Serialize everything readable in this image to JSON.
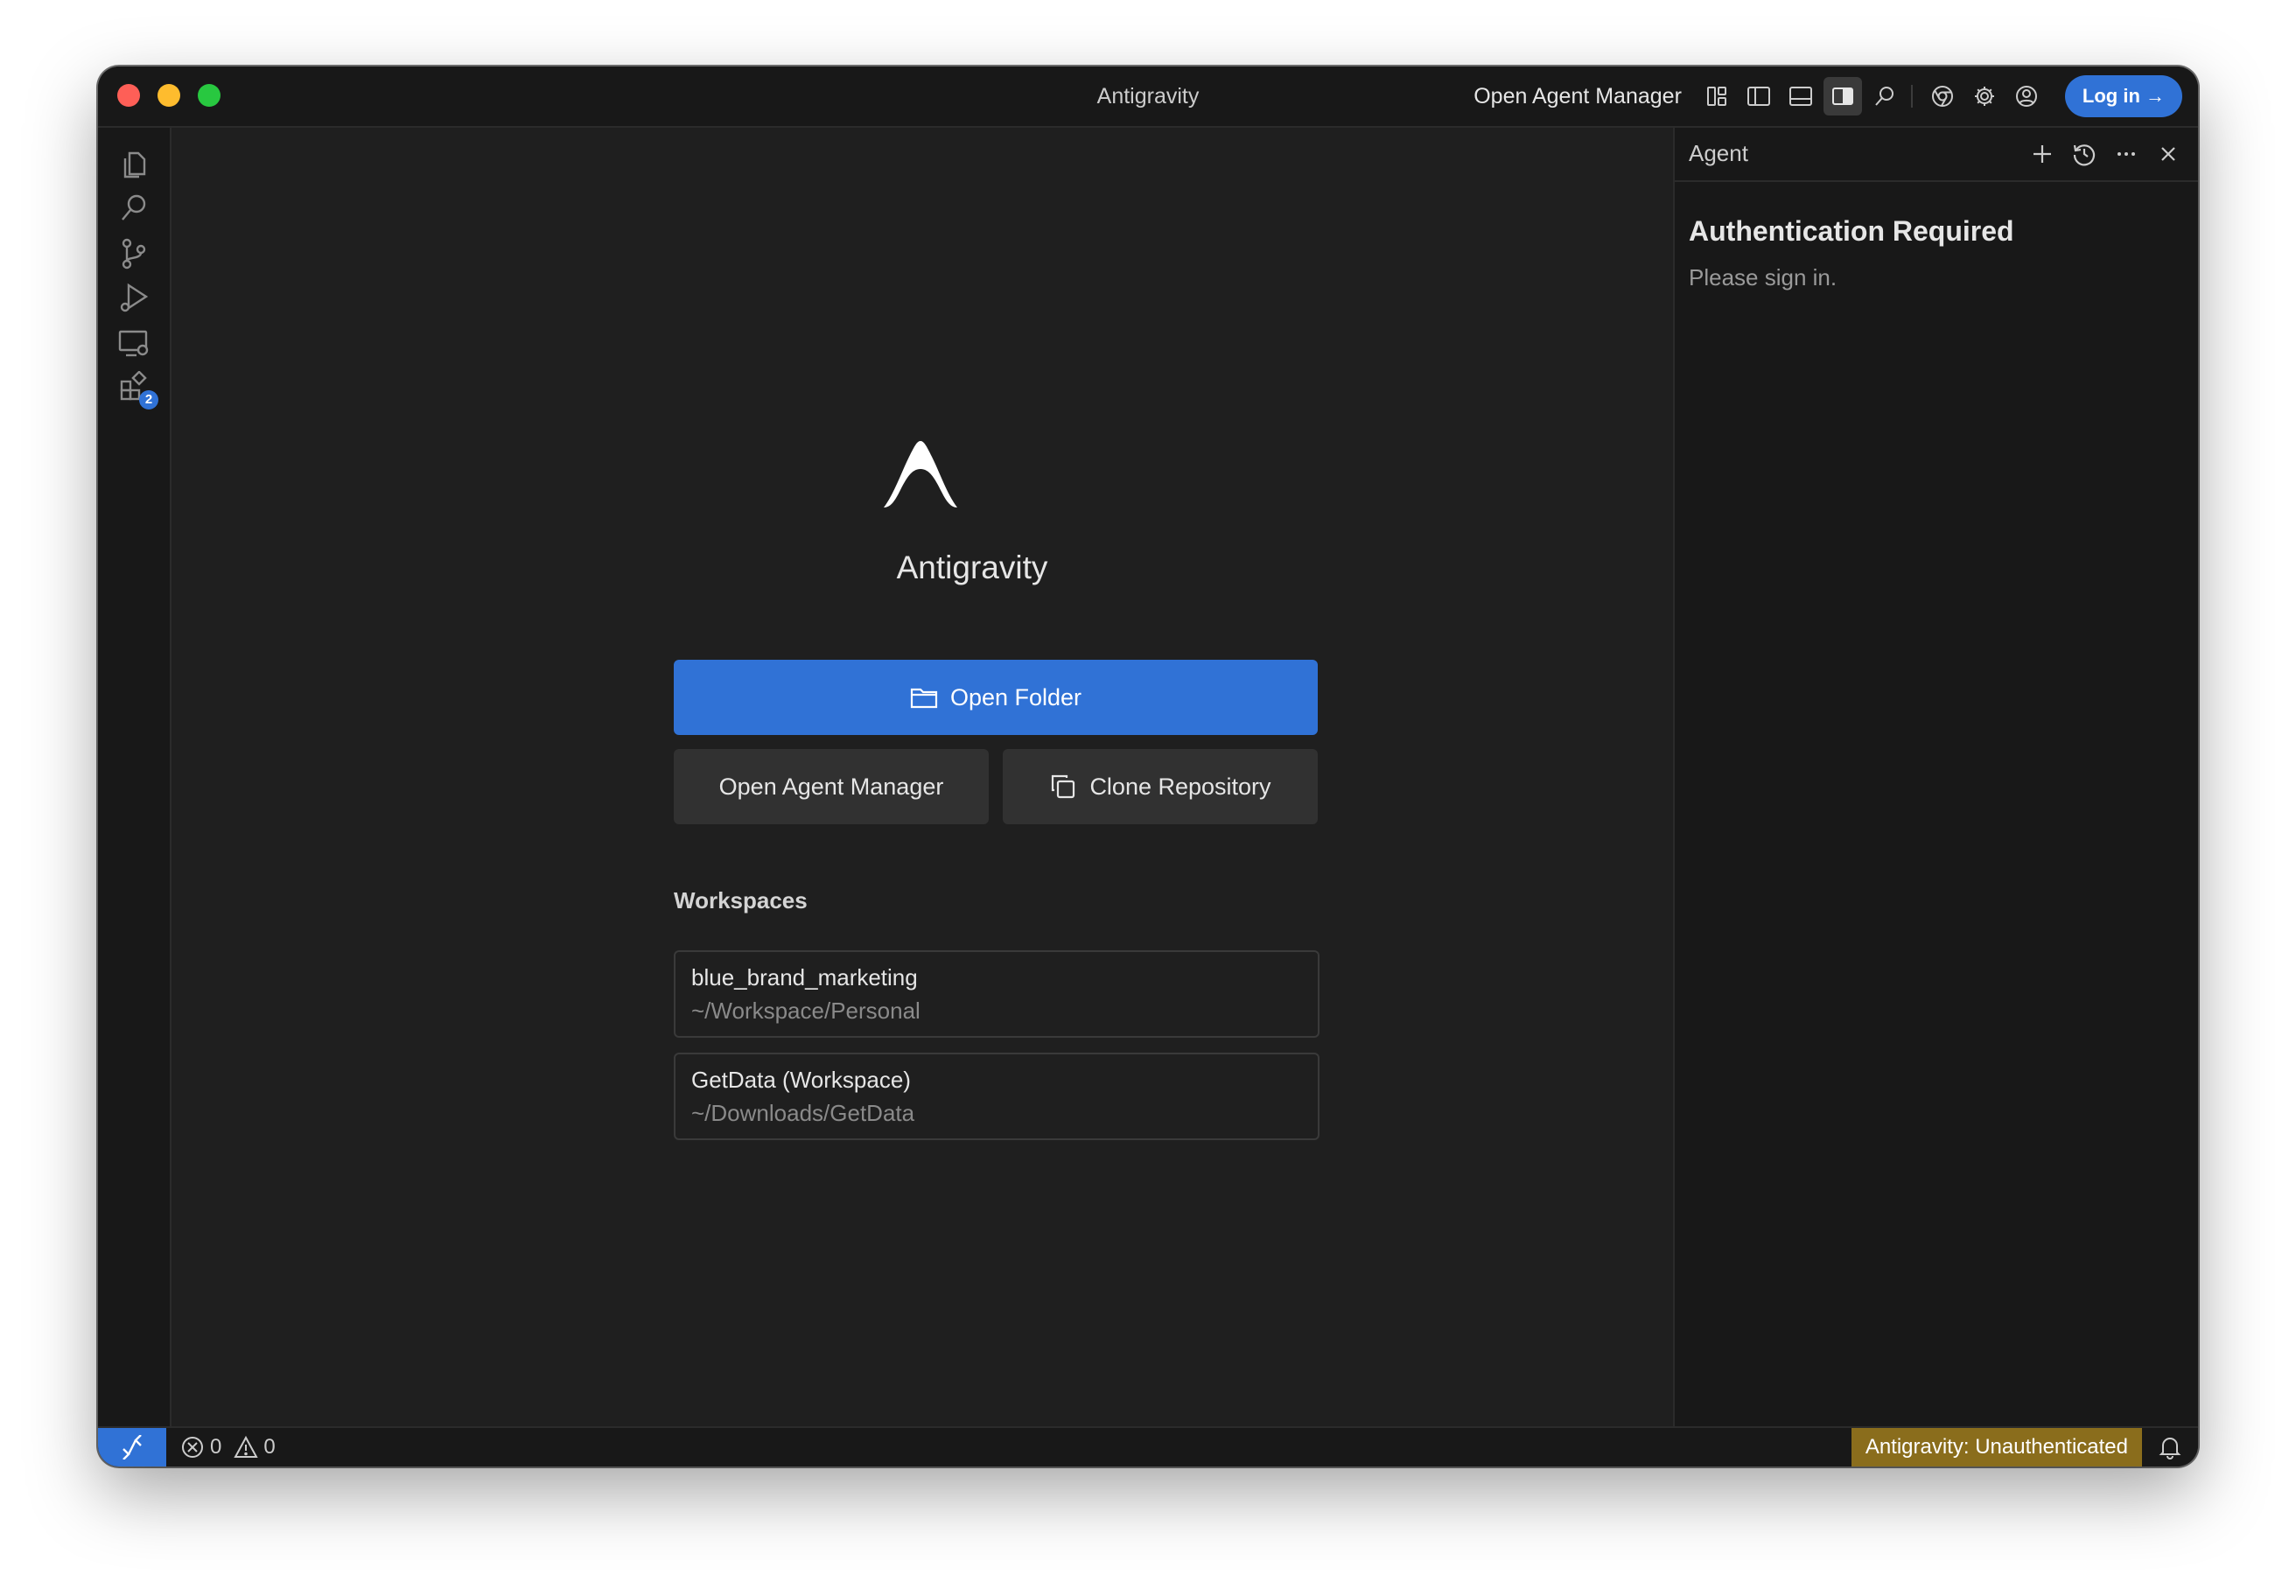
{
  "window": {
    "title": "Antigravity"
  },
  "titlebar": {
    "open_agent_manager": "Open Agent Manager",
    "login_label": "Log in →"
  },
  "activitybar": {
    "extensions_badge": "2"
  },
  "welcome": {
    "app_name": "Antigravity",
    "open_folder": "Open Folder",
    "open_agent_manager": "Open Agent Manager",
    "clone_repository": "Clone Repository",
    "workspaces_heading": "Workspaces",
    "workspaces": [
      {
        "name": "blue_brand_marketing",
        "path": "~/Workspace/Personal"
      },
      {
        "name": "GetData (Workspace)",
        "path": "~/Downloads/GetData"
      }
    ]
  },
  "agent": {
    "title": "Agent",
    "auth_title": "Authentication Required",
    "auth_text": "Please sign in."
  },
  "statusbar": {
    "errors": "0",
    "warnings": "0",
    "auth_status": "Antigravity: Unauthenticated"
  },
  "colors": {
    "accent": "#3072d6",
    "warning_bg": "#8a6d1c"
  },
  "icons": [
    "explorer-icon",
    "search-icon",
    "source-control-icon",
    "run-debug-icon",
    "remote-explorer-icon",
    "extensions-icon",
    "customize-layout-icon",
    "toggle-primary-sidebar-icon",
    "toggle-panel-icon",
    "toggle-secondary-sidebar-icon",
    "search-icon",
    "chrome-icon",
    "gear-icon",
    "account-icon",
    "folder-icon",
    "copy-icon",
    "plus-icon",
    "history-icon",
    "ellipsis-icon",
    "close-icon",
    "remote-icon",
    "error-icon",
    "warning-icon",
    "bell-icon"
  ]
}
